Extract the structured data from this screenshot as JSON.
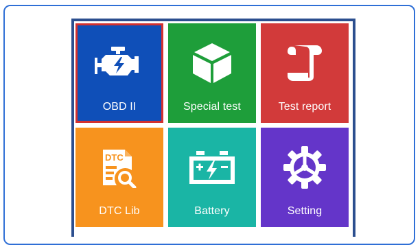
{
  "menu": {
    "tiles": [
      {
        "label": "OBD II",
        "icon": "engine-icon",
        "color": "#0f4fb8",
        "selected": true
      },
      {
        "label": "Special test",
        "icon": "cube-icon",
        "color": "#1e9e3a",
        "selected": false
      },
      {
        "label": "Test report",
        "icon": "scroll-report-icon",
        "color": "#d23a3a",
        "selected": false
      },
      {
        "label": "DTC Lib",
        "icon": "dtc-document-search-icon",
        "color": "#f7931e",
        "selected": false
      },
      {
        "label": "Battery",
        "icon": "battery-icon",
        "color": "#1ab5a5",
        "selected": false
      },
      {
        "label": "Setting",
        "icon": "gear-icon",
        "color": "#6435c9",
        "selected": false
      }
    ]
  },
  "colors": {
    "frame_border": "#2f6fd6",
    "device_border": "#2c4f8f",
    "selection": "#d3312f"
  },
  "icon_text": {
    "dtc": "DTC"
  }
}
